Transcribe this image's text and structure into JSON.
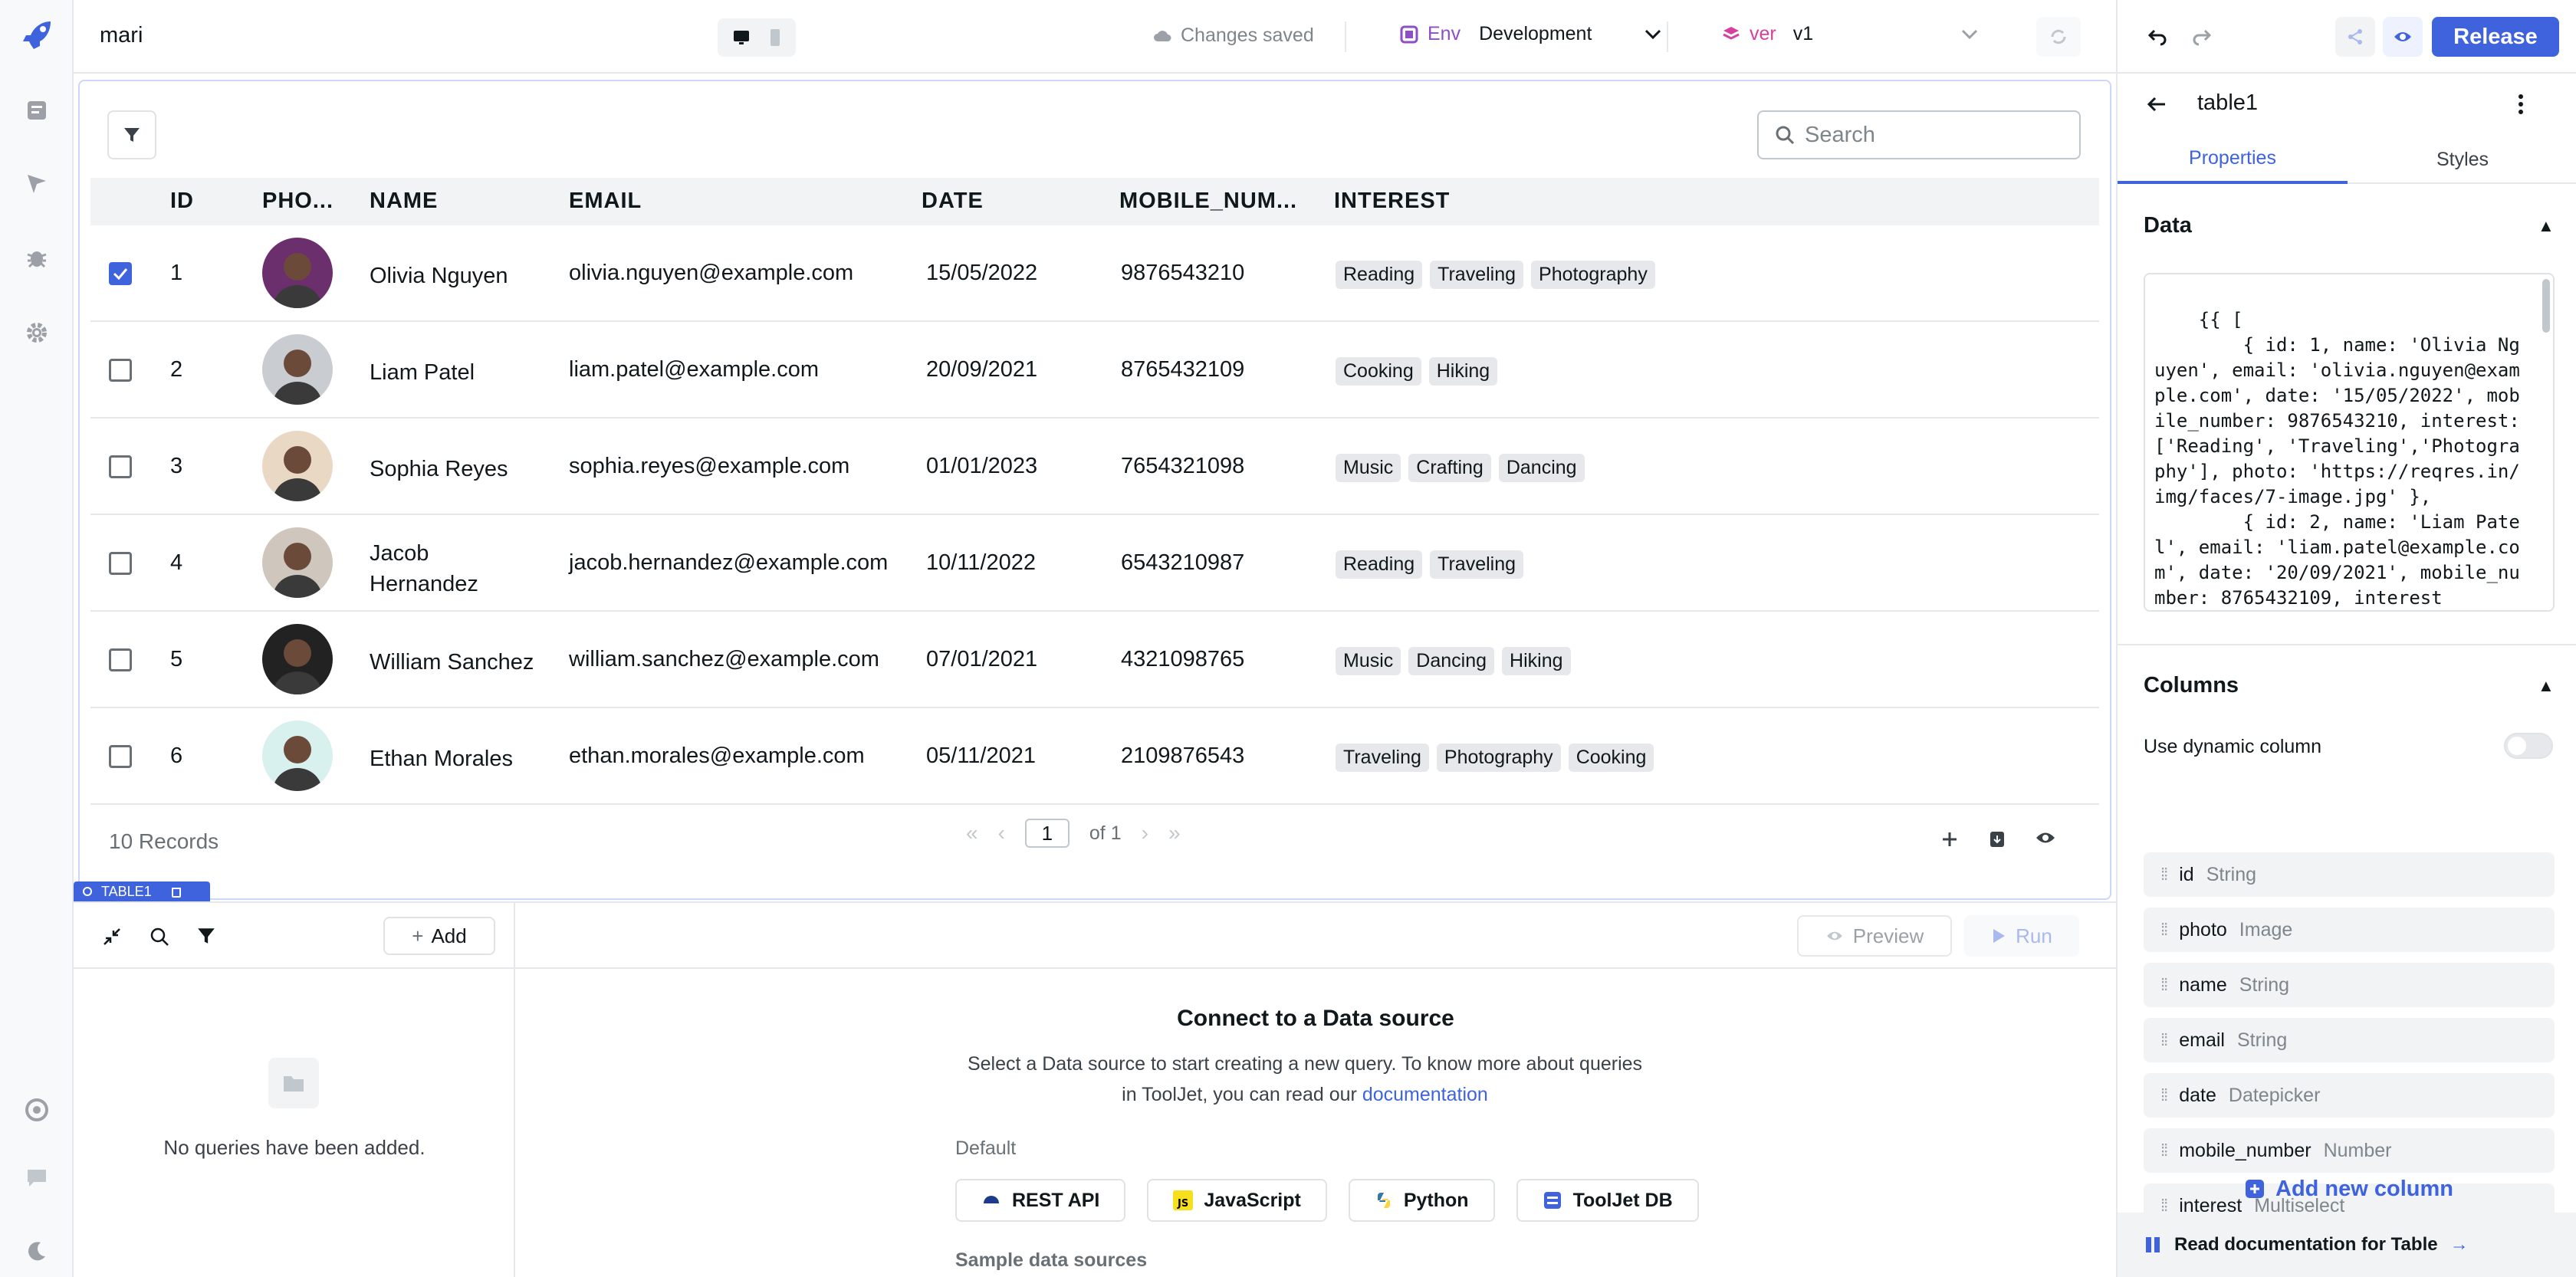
{
  "header": {
    "app_name": "mari",
    "saved_status": "Changes saved",
    "env_key": "Env",
    "env_value": "Development",
    "ver_key": "ver",
    "ver_value": "v1",
    "release_label": "Release"
  },
  "table": {
    "search_placeholder": "Search",
    "columns": [
      "ID",
      "PHO...",
      "NAME",
      "EMAIL",
      "DATE",
      "MOBILE_NUM...",
      "INTEREST"
    ],
    "rows": [
      {
        "checked": true,
        "id": "1",
        "name": "Olivia Nguyen",
        "email": "olivia.nguyen@example.com",
        "date": "15/05/2022",
        "mobile": "9876543210",
        "interests": [
          "Reading",
          "Traveling",
          "Photography"
        ],
        "avatar_color": "#6b2f6e"
      },
      {
        "checked": false,
        "id": "2",
        "name": "Liam Patel",
        "email": "liam.patel@example.com",
        "date": "20/09/2021",
        "mobile": "8765432109",
        "interests": [
          "Cooking",
          "Hiking"
        ],
        "avatar_color": "#c9ccd1"
      },
      {
        "checked": false,
        "id": "3",
        "name": "Sophia Reyes",
        "email": "sophia.reyes@example.com",
        "date": "01/01/2023",
        "mobile": "7654321098",
        "interests": [
          "Music",
          "Crafting",
          "Dancing"
        ],
        "avatar_color": "#e9d9c4"
      },
      {
        "checked": false,
        "id": "4",
        "name": "Jacob Hernandez",
        "email": "jacob.hernandez@example.com",
        "date": "10/11/2022",
        "mobile": "6543210987",
        "interests": [
          "Reading",
          "Traveling"
        ],
        "avatar_color": "#cfc6bd"
      },
      {
        "checked": false,
        "id": "5",
        "name": "William Sanchez",
        "email": "william.sanchez@example.com",
        "date": "07/01/2021",
        "mobile": "4321098765",
        "interests": [
          "Music",
          "Dancing",
          "Hiking"
        ],
        "avatar_color": "#222222"
      },
      {
        "checked": false,
        "id": "6",
        "name": "Ethan Morales",
        "email": "ethan.morales@example.com",
        "date": "05/11/2021",
        "mobile": "2109876543",
        "interests": [
          "Traveling",
          "Photography",
          "Cooking"
        ],
        "avatar_color": "#d8f0ee"
      }
    ],
    "records_label": "10 Records",
    "page_current": "1",
    "page_of": "of 1",
    "widget_tag": "TABLE1"
  },
  "query_panel": {
    "add_label": "Add",
    "no_queries": "No queries have been added.",
    "preview_label": "Preview",
    "run_label": "Run",
    "connect_title": "Connect to a Data source",
    "connect_desc": "Select a Data source to start creating a new query. To know more about queries in ToolJet, you can read our",
    "doc_link": "documentation",
    "default_label": "Default",
    "datasources": [
      "REST API",
      "JavaScript",
      "Python",
      "ToolJet DB"
    ],
    "sample_label": "Sample data sources"
  },
  "inspector": {
    "component_name": "table1",
    "tab_properties": "Properties",
    "tab_styles": "Styles",
    "data_title": "Data",
    "data_code": "{{ [\n        { id: 1, name: 'Olivia Nguyen', email: 'olivia.nguyen@example.com', date: '15/05/2022', mobile_number: 9876543210, interest: ['Reading', 'Traveling','Photography'], photo: 'https://reqres.in/img/faces/7-image.jpg' },\n        { id: 2, name: 'Liam Patel', email: 'liam.patel@example.com', date: '20/09/2021', mobile_number: 8765432109, interest",
    "columns_title": "Columns",
    "dynamic_label": "Use dynamic column",
    "column_items": [
      {
        "name": "id",
        "type": "String"
      },
      {
        "name": "photo",
        "type": "Image"
      },
      {
        "name": "name",
        "type": "String"
      },
      {
        "name": "email",
        "type": "String"
      },
      {
        "name": "date",
        "type": "Datepicker"
      },
      {
        "name": "mobile_number",
        "type": "Number"
      },
      {
        "name": "interest",
        "type": "Multiselect"
      }
    ],
    "add_column": "Add new column",
    "read_docs": "Read documentation for Table"
  },
  "colors": {
    "accent": "#3e63dd",
    "border": "#e6e8eb"
  }
}
